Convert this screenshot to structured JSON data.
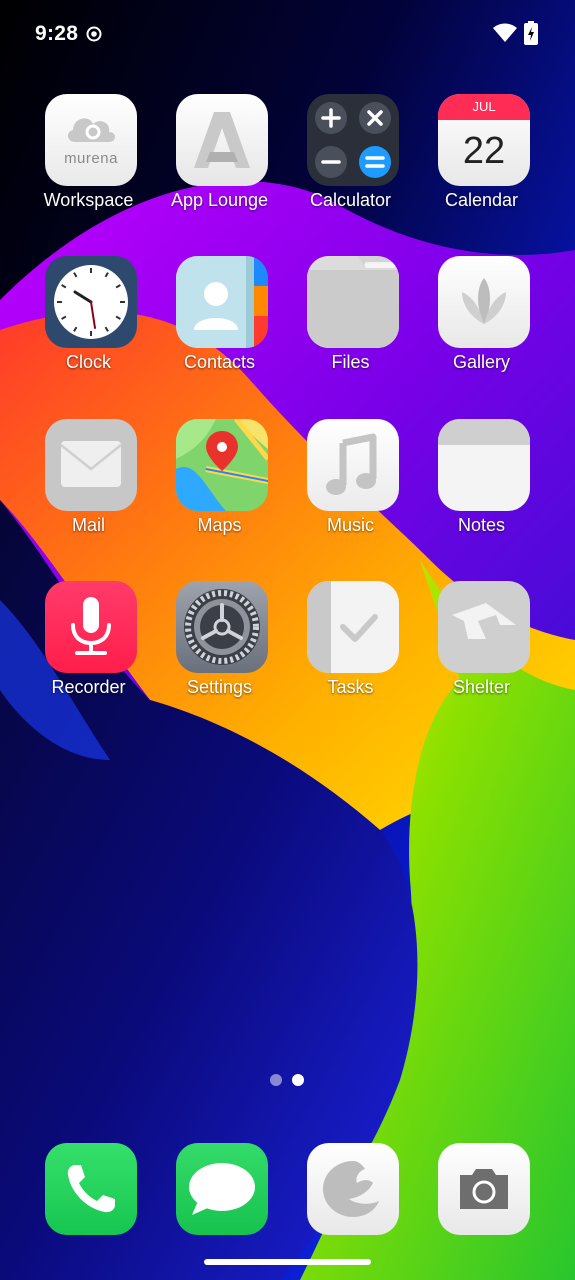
{
  "status_bar": {
    "time": "9:28",
    "wifi_icon": "wifi-icon",
    "battery_icon": "battery-charging-icon"
  },
  "apps": [
    {
      "label": "Workspace",
      "icon": "murena-workspace-icon",
      "icon_text": "murena"
    },
    {
      "label": "App Lounge",
      "icon": "app-lounge-icon"
    },
    {
      "label": "Calculator",
      "icon": "calculator-icon"
    },
    {
      "label": "Calendar",
      "icon": "calendar-icon",
      "month": "JUL",
      "day": "22"
    },
    {
      "label": "Clock",
      "icon": "clock-icon"
    },
    {
      "label": "Contacts",
      "icon": "contacts-icon"
    },
    {
      "label": "Files",
      "icon": "folder-icon"
    },
    {
      "label": "Gallery",
      "icon": "gallery-icon"
    },
    {
      "label": "Mail",
      "icon": "mail-icon"
    },
    {
      "label": "Maps",
      "icon": "maps-icon"
    },
    {
      "label": "Music",
      "icon": "music-icon"
    },
    {
      "label": "Notes",
      "icon": "notes-icon"
    },
    {
      "label": "Recorder",
      "icon": "microphone-icon"
    },
    {
      "label": "Settings",
      "icon": "gear-icon"
    },
    {
      "label": "Tasks",
      "icon": "tasks-icon"
    },
    {
      "label": "Shelter",
      "icon": "shelter-icon"
    }
  ],
  "pager": {
    "pages": 2,
    "current_page": 2
  },
  "dock": [
    {
      "icon": "phone-icon"
    },
    {
      "icon": "messages-icon"
    },
    {
      "icon": "browser-icon"
    },
    {
      "icon": "camera-icon"
    }
  ],
  "colors": {
    "recorder": "#ff2d55",
    "phone": "#1ed760",
    "messages": "#22c55e",
    "calendar_header": "#ff2d55"
  }
}
